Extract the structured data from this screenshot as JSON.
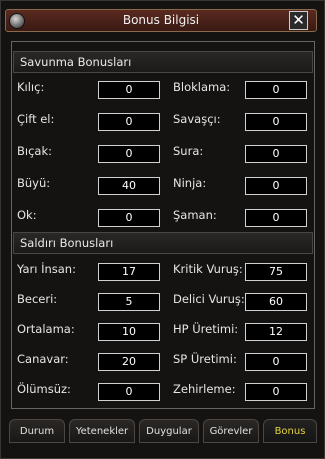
{
  "window": {
    "title": "Bonus Bilgisi",
    "close_symbol": "✕"
  },
  "sections": {
    "defense": {
      "title": "Savunma Bonusları",
      "rows": [
        {
          "left_label": "Kılıç:",
          "left_value": "0",
          "right_label": "Bloklama:",
          "right_value": "0"
        },
        {
          "left_label": "Çift el:",
          "left_value": "0",
          "right_label": "Savaşçı:",
          "right_value": "0"
        },
        {
          "left_label": "Bıçak:",
          "left_value": "0",
          "right_label": "Sura:",
          "right_value": "0"
        },
        {
          "left_label": "Büyü:",
          "left_value": "40",
          "right_label": "Ninja:",
          "right_value": "0"
        },
        {
          "left_label": "Ok:",
          "left_value": "0",
          "right_label": "Şaman:",
          "right_value": "0"
        }
      ]
    },
    "attack": {
      "title": "Saldırı Bonusları",
      "rows": [
        {
          "left_label": "Yarı İnsan:",
          "left_value": "17",
          "right_label": "Kritik Vuruş:",
          "right_value": "75"
        },
        {
          "left_label": "Beceri:",
          "left_value": "5",
          "right_label": "Delici Vuruş:",
          "right_value": "60"
        },
        {
          "left_label": "Ortalama:",
          "left_value": "10",
          "right_label": "HP Üretimi:",
          "right_value": "12"
        },
        {
          "left_label": "Canavar:",
          "left_value": "20",
          "right_label": "SP Üretimi:",
          "right_value": "0"
        },
        {
          "left_label": "Ölümsüz:",
          "left_value": "0",
          "right_label": "Zehirleme:",
          "right_value": "0"
        }
      ]
    }
  },
  "tabs": [
    {
      "label": "Durum",
      "active": false
    },
    {
      "label": "Yetenekler",
      "active": false
    },
    {
      "label": "Duygular",
      "active": false
    },
    {
      "label": "Görevler",
      "active": false
    },
    {
      "label": "Bonus",
      "active": true
    }
  ],
  "colors": {
    "active_tab": "#e4d23a",
    "title_bar": "#4a2218"
  }
}
